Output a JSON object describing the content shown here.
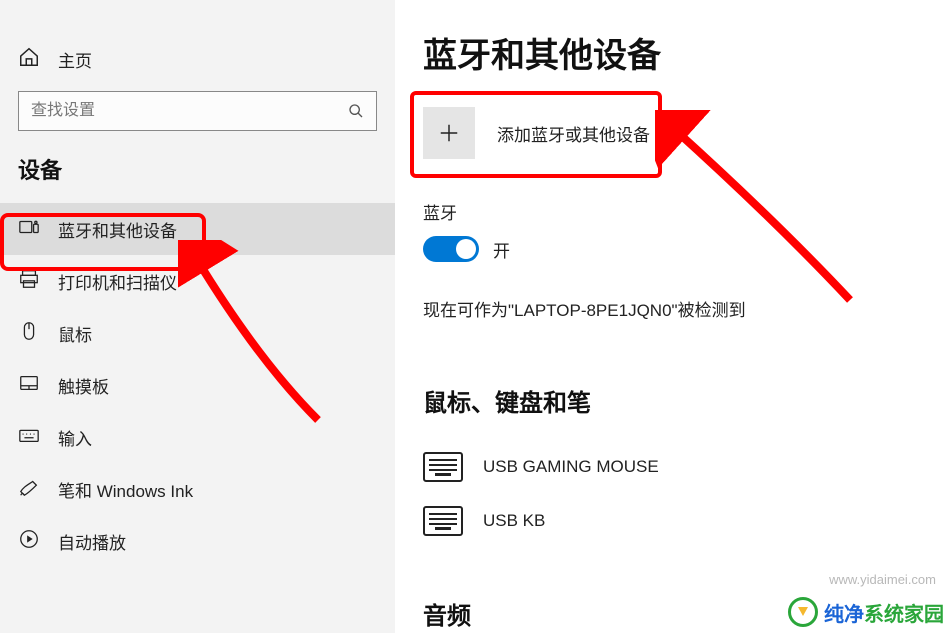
{
  "sidebar": {
    "home": "主页",
    "search_placeholder": "查找设置",
    "section": "设备",
    "items": [
      {
        "label": "蓝牙和其他设备"
      },
      {
        "label": "打印机和扫描仪"
      },
      {
        "label": "鼠标"
      },
      {
        "label": "触摸板"
      },
      {
        "label": "输入"
      },
      {
        "label": "笔和 Windows Ink"
      },
      {
        "label": "自动播放"
      }
    ]
  },
  "main": {
    "title": "蓝牙和其他设备",
    "add_device": "添加蓝牙或其他设备",
    "bluetooth_label": "蓝牙",
    "toggle_state": "开",
    "discoverable_prefix": "现在可作为\"",
    "device_name": "LAPTOP-8PE1JQN0",
    "discoverable_suffix": "\"被检测到",
    "group_mouse_kb": "鼠标、键盘和笔",
    "devices": [
      {
        "name": "USB GAMING MOUSE"
      },
      {
        "name": "USB KB"
      }
    ],
    "group_audio": "音频"
  },
  "watermark": "www.yidaimei.com",
  "brand": {
    "a": "纯净",
    "b": "系统家园"
  }
}
